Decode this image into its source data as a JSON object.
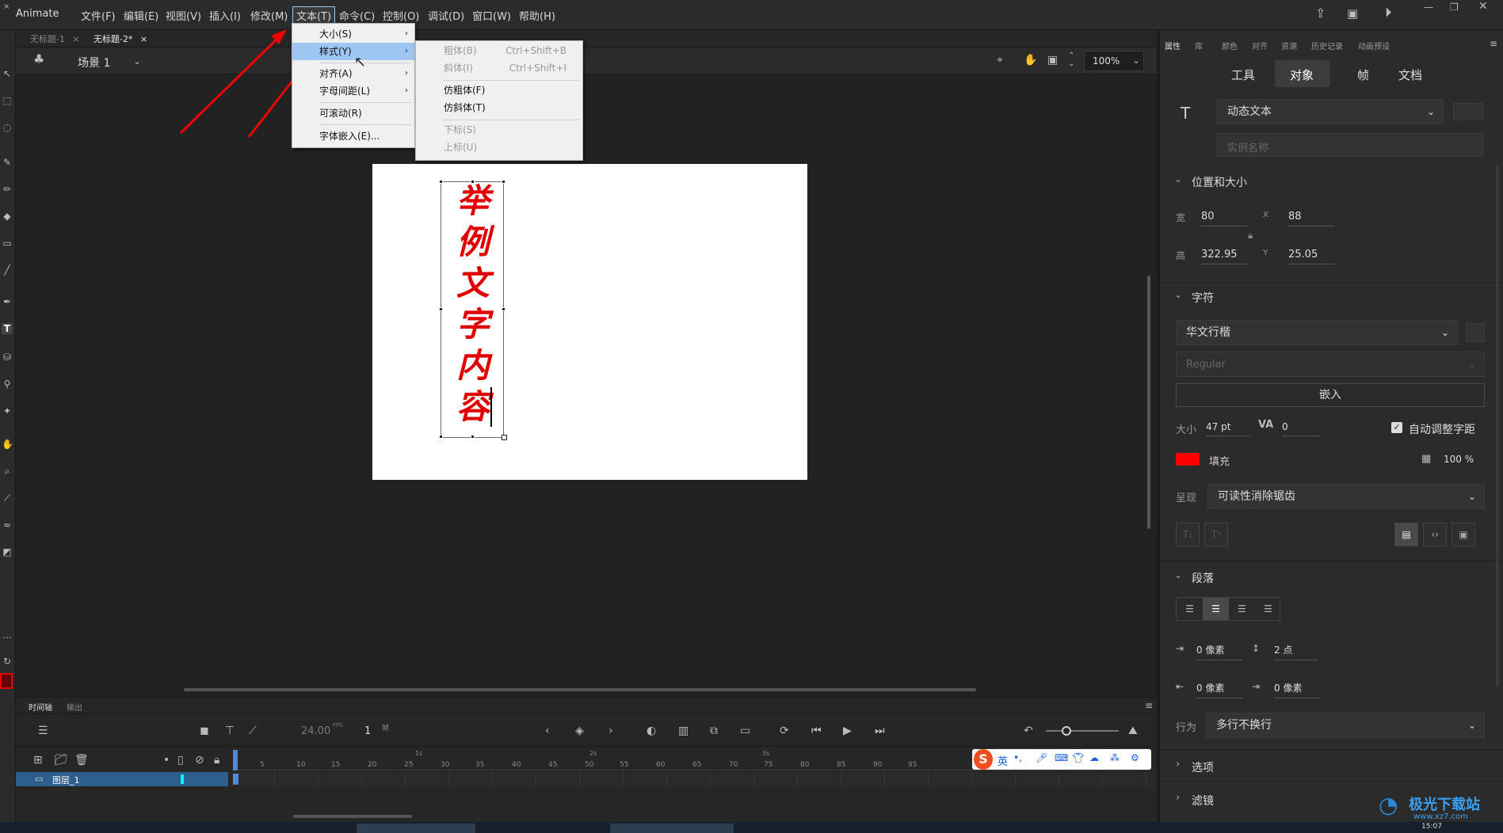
{
  "app": {
    "name": "Animate"
  },
  "menubar": {
    "items": [
      "文件(F)",
      "编辑(E)",
      "视图(V)",
      "插入(I)",
      "修改(M)",
      "文本(T)",
      "命令(C)",
      "控制(O)",
      "调试(D)",
      "窗口(W)",
      "帮助(H)"
    ]
  },
  "doc_tabs": [
    "无标题-1",
    "无标题-2*"
  ],
  "scene": {
    "label": "场景 1",
    "zoom": "100%"
  },
  "stage": {
    "text_chars": [
      "举",
      "例",
      "文",
      "字",
      "内",
      "容"
    ],
    "text_color": "#e00000"
  },
  "text_menu": {
    "items": [
      {
        "label": "大小(S)",
        "arrow": "›"
      },
      {
        "label": "样式(Y)",
        "arrow": "›"
      },
      {
        "label": "对齐(A)",
        "arrow": "›"
      },
      {
        "label": "字母间距(L)",
        "arrow": "›"
      },
      {
        "label": "可滚动(R)",
        "arrow": ""
      },
      {
        "label": "字体嵌入(E)...",
        "arrow": ""
      }
    ]
  },
  "style_submenu": {
    "items": [
      {
        "label": "粗体(B)",
        "shortcut": "Ctrl+Shift+B",
        "enabled": false
      },
      {
        "label": "斜体(I)",
        "shortcut": "Ctrl+Shift+I",
        "enabled": false
      },
      {
        "label": "仿粗体(F)",
        "shortcut": "",
        "enabled": true
      },
      {
        "label": "仿斜体(T)",
        "shortcut": "",
        "enabled": true
      },
      {
        "label": "下标(S)",
        "shortcut": "",
        "enabled": false
      },
      {
        "label": "上标(U)",
        "shortcut": "",
        "enabled": false
      }
    ]
  },
  "panel": {
    "top_tabs": [
      "属性",
      "库",
      "颜色",
      "对齐",
      "资源",
      "历史记录",
      "动画预设"
    ],
    "segments": [
      "工具",
      "对象",
      "帧",
      "文档"
    ],
    "active_segment": "对象",
    "text_type": "动态文本",
    "instance_placeholder": "实例名称",
    "position_section": "位置和大小",
    "w_label": "宽",
    "w": "80",
    "x_label": "X",
    "x": "88",
    "h_label": "高",
    "h": "322.95",
    "y_label": "Y",
    "y": "25.05",
    "char_section": "字符",
    "font": "华文行楷",
    "font_style": "Regular",
    "embed_button": "嵌入",
    "size_label": "大小",
    "size": "47 pt",
    "spacing": "0",
    "auto_kern": "自动调整字距",
    "fill_label": "填充",
    "fill_color": "#ff0000",
    "alpha": "100 %",
    "render_label": "呈现",
    "render": "可读性消除锯齿",
    "para_section": "段落",
    "indent": "0 像素",
    "line_spacing": "2 点",
    "left_margin": "0 像素",
    "right_margin": "0 像素",
    "behavior_label": "行为",
    "behavior": "多行不换行",
    "options_section": "选项",
    "filters_section": "滤镜"
  },
  "timeline": {
    "tabs": [
      "时间轴",
      "输出"
    ],
    "fps": "24.00",
    "fps_unit": "FPS",
    "frame": "1",
    "frame_unit": "帧",
    "layer_name": "图层_1",
    "ruler_numbers": [
      "5",
      "10",
      "15",
      "20",
      "25",
      "30",
      "35",
      "40",
      "45",
      "50",
      "55",
      "60",
      "65",
      "70",
      "75",
      "80",
      "85",
      "90",
      "95"
    ],
    "second_marks": [
      "1s",
      "2s",
      "3s"
    ]
  },
  "ime": {
    "lang": "英"
  },
  "watermark": {
    "text": "极光下载站",
    "url": "www.xz7.com"
  },
  "clock": "15:07"
}
